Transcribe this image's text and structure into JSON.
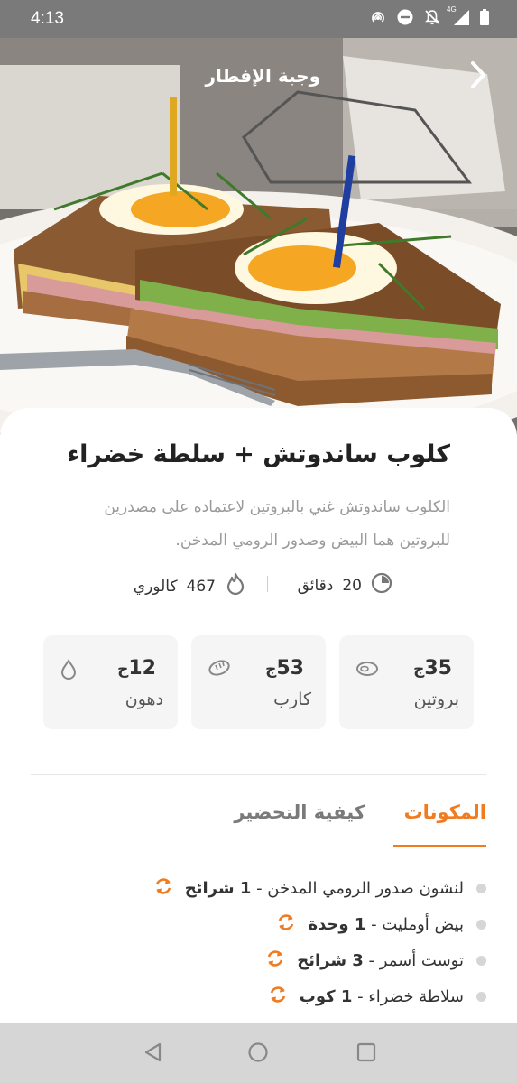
{
  "status_bar": {
    "time": "4:13",
    "network_label": "4G",
    "icons": [
      "hotspot-icon",
      "do-not-disturb-icon",
      "notifications-off-icon",
      "signal-icon",
      "battery-icon"
    ]
  },
  "header": {
    "title": "وجبة الإفطار",
    "back_icon": "chevron-right-icon"
  },
  "meal": {
    "title": "كلوب ساندوتش + سلطة خضراء",
    "description": "الكلوب ساندوتش غني بالبروتين لاعتماده على مصدرين للبروتين هما البيض وصدور الرومي المدخن.",
    "time_value": "20",
    "time_unit": "دقائق",
    "calories_value": "467",
    "calories_unit": "كالوري"
  },
  "nutrition": {
    "protein": {
      "value": "35",
      "unit": "ج",
      "label": "بروتين",
      "icon": "meat-icon"
    },
    "carb": {
      "value": "53",
      "unit": "ج",
      "label": "كارب",
      "icon": "bread-icon"
    },
    "fat": {
      "value": "12",
      "unit": "ج",
      "label": "دهون",
      "icon": "drop-icon"
    }
  },
  "tabs": {
    "ingredients": "المكونات",
    "preparation": "كيفية التحضير",
    "active": "ingredients"
  },
  "ingredients": [
    {
      "name": "لنشون صدور الرومي المدخن",
      "qty": "1 شرائح"
    },
    {
      "name": "بيض أومليت",
      "qty": "1 وحدة"
    },
    {
      "name": "توست أسمر",
      "qty": "3 شرائح"
    },
    {
      "name": "سلاطة خضراء",
      "qty": "1 كوب"
    }
  ],
  "colors": {
    "accent": "#f07c22",
    "status_bar": "#7a7a7a",
    "nav_bar": "#d6d6d6",
    "card_background": "#f5f5f5"
  }
}
